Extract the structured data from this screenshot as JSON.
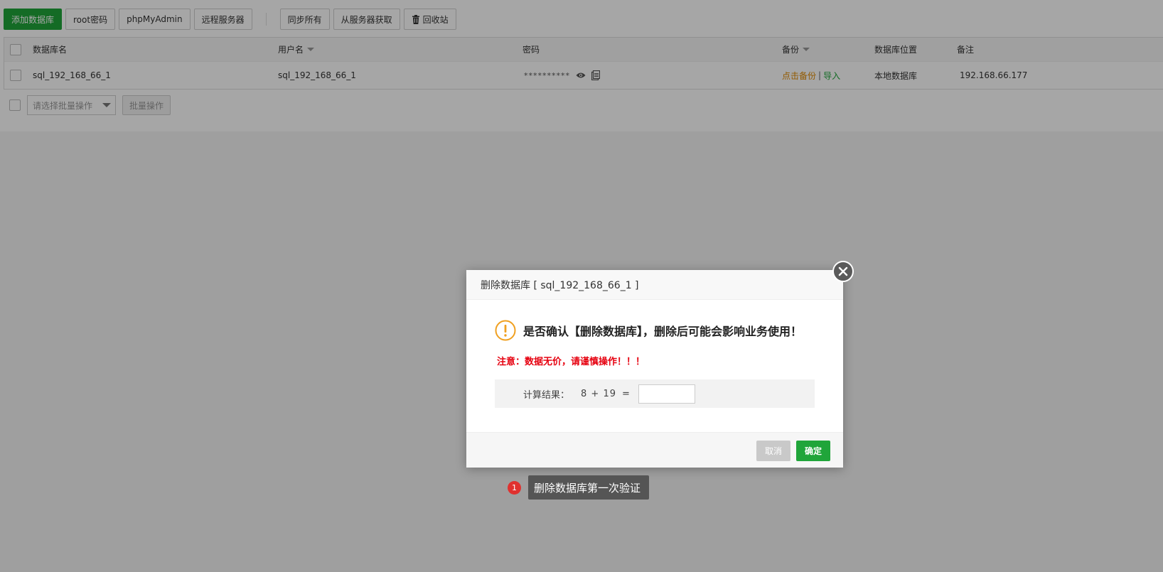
{
  "toolbar": {
    "add_db": "添加数据库",
    "root_pw": "root密码",
    "phpmyadmin": "phpMyAdmin",
    "remote_server": "远程服务器",
    "sync_all": "同步所有",
    "fetch_from_server": "从服务器获取",
    "recycle_bin": "回收站"
  },
  "table": {
    "headers": {
      "db_name": "数据库名",
      "username": "用户名",
      "password": "密码",
      "backup": "备份",
      "location": "数据库位置",
      "note": "备注"
    },
    "rows": [
      {
        "db_name": "sql_192_168_66_1",
        "username": "sql_192_168_66_1",
        "password_mask": "**********",
        "backup_link": "点击备份",
        "backup_sep": "|",
        "import_link": "导入",
        "location": "本地数据库",
        "note": "192.168.66.177"
      }
    ]
  },
  "batch": {
    "select_placeholder": "请选择批量操作",
    "action": "批量操作"
  },
  "dialog": {
    "title": "删除数据库 [ sql_192_168_66_1 ]",
    "warning": "是否确认【删除数据库】，删除后可能会影响业务使用！",
    "notice": "注意：数据无价，请谨慎操作！！！",
    "calc_label": "计算结果：",
    "calc_expr": "8 + 19",
    "calc_eq": "=",
    "calc_value": "",
    "cancel": "取消",
    "confirm": "确定"
  },
  "step": {
    "number": "1",
    "label": "删除数据库第一次验证"
  },
  "colors": {
    "primary_green": "#20a53a",
    "danger_red": "#e6000f",
    "warning_orange": "#e18a00",
    "badge_red": "#e0312f"
  }
}
